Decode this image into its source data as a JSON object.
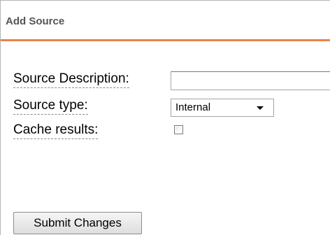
{
  "panel": {
    "title": "Add Source",
    "accent_color": "#e8834a"
  },
  "form": {
    "description": {
      "label": "Source Description:",
      "value": "",
      "placeholder": ""
    },
    "type": {
      "label": "Source type:",
      "selected": "Internal"
    },
    "cache": {
      "label": "Cache results:",
      "checked": false
    }
  },
  "actions": {
    "submit_label": "Submit Changes"
  }
}
